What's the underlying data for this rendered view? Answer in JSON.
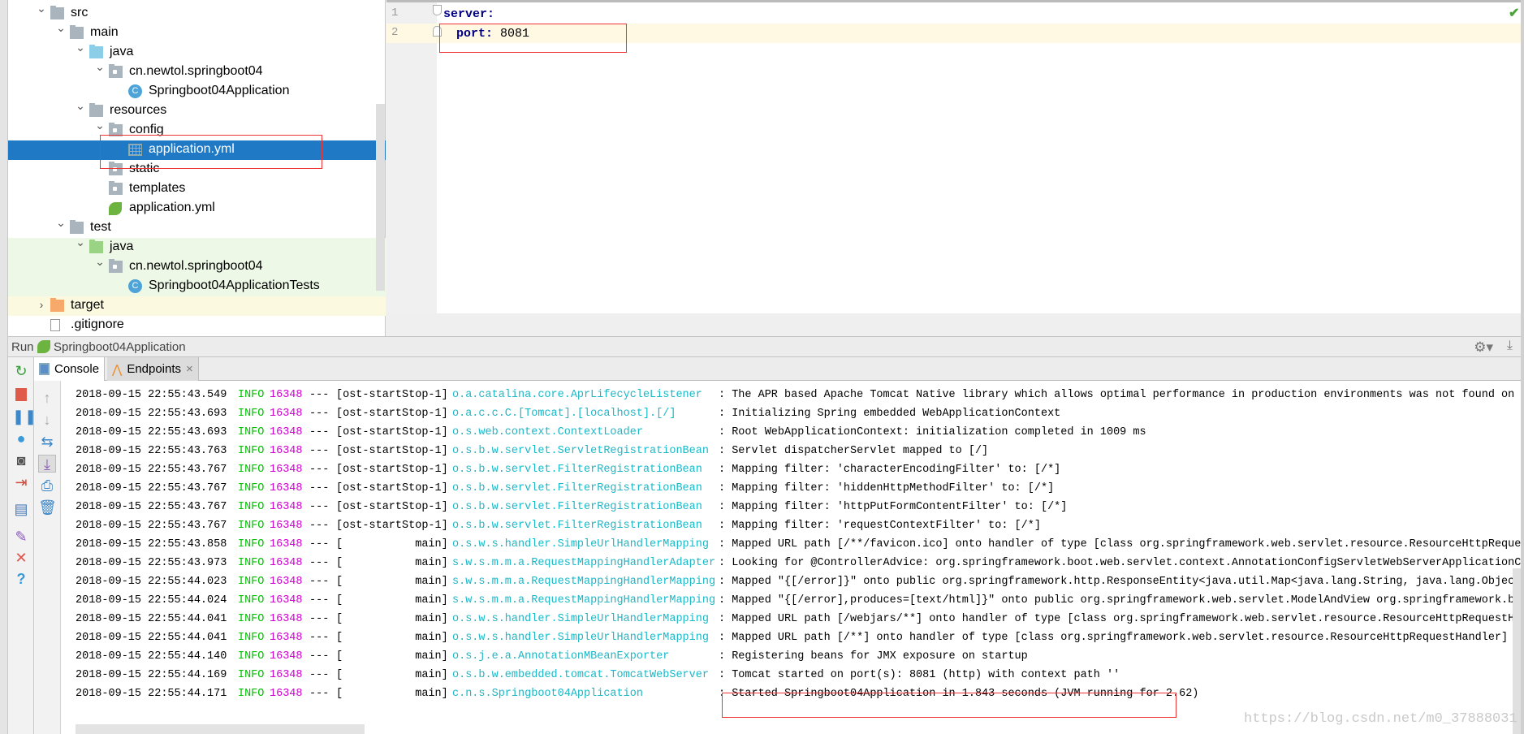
{
  "project_tree": [
    {
      "label": "src",
      "depth": 0,
      "chevron": "down",
      "icon": "folder-icon",
      "style": ""
    },
    {
      "label": "main",
      "depth": 1,
      "chevron": "down",
      "icon": "folder-icon",
      "style": ""
    },
    {
      "label": "java",
      "depth": 2,
      "chevron": "down",
      "icon": "source-folder-icon",
      "style": ""
    },
    {
      "label": "cn.newtol.springboot04",
      "depth": 3,
      "chevron": "down",
      "icon": "package-icon",
      "style": ""
    },
    {
      "label": "Springboot04Application",
      "depth": 4,
      "chevron": "",
      "icon": "spring-boot-class-icon",
      "style": ""
    },
    {
      "label": "resources",
      "depth": 2,
      "chevron": "down",
      "icon": "resources-folder-icon",
      "style": ""
    },
    {
      "label": "config",
      "depth": 3,
      "chevron": "down",
      "icon": "package-icon",
      "style": ""
    },
    {
      "label": "application.yml",
      "depth": 4,
      "chevron": "",
      "icon": "yaml-file-icon",
      "style": "sel"
    },
    {
      "label": "static",
      "depth": 3,
      "chevron": "",
      "icon": "package-icon",
      "style": ""
    },
    {
      "label": "templates",
      "depth": 3,
      "chevron": "",
      "icon": "package-icon",
      "style": ""
    },
    {
      "label": "application.yml",
      "depth": 3,
      "chevron": "",
      "icon": "spring-config-icon",
      "style": ""
    },
    {
      "label": "test",
      "depth": 1,
      "chevron": "down",
      "icon": "folder-icon",
      "style": ""
    },
    {
      "label": "java",
      "depth": 2,
      "chevron": "down",
      "icon": "test-folder-icon",
      "style": "test"
    },
    {
      "label": "cn.newtol.springboot04",
      "depth": 3,
      "chevron": "down",
      "icon": "package-icon",
      "style": "test"
    },
    {
      "label": "Springboot04ApplicationTests",
      "depth": 4,
      "chevron": "",
      "icon": "test-class-icon",
      "style": "test"
    },
    {
      "label": "target",
      "depth": 0,
      "chevron": "right",
      "icon": "excluded-folder-icon",
      "style": "target"
    },
    {
      "label": ".gitignore",
      "depth": 0,
      "chevron": "",
      "icon": "text-file-icon",
      "style": ""
    }
  ],
  "editor": {
    "line_numbers": [
      "1",
      "2"
    ],
    "line1_key": "server:",
    "line2_key": "port:",
    "line2_value": " 8081",
    "status_icon": "checkmark-icon"
  },
  "run_bar": {
    "label": "Run",
    "config": "Springboot04Application"
  },
  "tabs": {
    "console": "Console",
    "endpoints": "Endpoints",
    "close": "×"
  },
  "console_lines": [
    {
      "ts": "2018-09-15 22:55:43.549",
      "level": "INFO",
      "pid": "16348",
      "sep": "---",
      "thread": "[ost-startStop-1]",
      "logger": "o.a.catalina.core.AprLifecycleListener",
      "msg": ": The APR based Apache Tomcat Native library which allows optimal performance in production environments was not found on th"
    },
    {
      "ts": "2018-09-15 22:55:43.693",
      "level": "INFO",
      "pid": "16348",
      "sep": "---",
      "thread": "[ost-startStop-1]",
      "logger": "o.a.c.c.C.[Tomcat].[localhost].[/]",
      "msg": ": Initializing Spring embedded WebApplicationContext"
    },
    {
      "ts": "2018-09-15 22:55:43.693",
      "level": "INFO",
      "pid": "16348",
      "sep": "---",
      "thread": "[ost-startStop-1]",
      "logger": "o.s.web.context.ContextLoader",
      "msg": ": Root WebApplicationContext: initialization completed in 1009 ms"
    },
    {
      "ts": "2018-09-15 22:55:43.763",
      "level": "INFO",
      "pid": "16348",
      "sep": "---",
      "thread": "[ost-startStop-1]",
      "logger": "o.s.b.w.servlet.ServletRegistrationBean",
      "msg": ": Servlet dispatcherServlet mapped to [/]"
    },
    {
      "ts": "2018-09-15 22:55:43.767",
      "level": "INFO",
      "pid": "16348",
      "sep": "---",
      "thread": "[ost-startStop-1]",
      "logger": "o.s.b.w.servlet.FilterRegistrationBean",
      "msg": ": Mapping filter: 'characterEncodingFilter' to: [/*]"
    },
    {
      "ts": "2018-09-15 22:55:43.767",
      "level": "INFO",
      "pid": "16348",
      "sep": "---",
      "thread": "[ost-startStop-1]",
      "logger": "o.s.b.w.servlet.FilterRegistrationBean",
      "msg": ": Mapping filter: 'hiddenHttpMethodFilter' to: [/*]"
    },
    {
      "ts": "2018-09-15 22:55:43.767",
      "level": "INFO",
      "pid": "16348",
      "sep": "---",
      "thread": "[ost-startStop-1]",
      "logger": "o.s.b.w.servlet.FilterRegistrationBean",
      "msg": ": Mapping filter: 'httpPutFormContentFilter' to: [/*]"
    },
    {
      "ts": "2018-09-15 22:55:43.767",
      "level": "INFO",
      "pid": "16348",
      "sep": "---",
      "thread": "[ost-startStop-1]",
      "logger": "o.s.b.w.servlet.FilterRegistrationBean",
      "msg": ": Mapping filter: 'requestContextFilter' to: [/*]"
    },
    {
      "ts": "2018-09-15 22:55:43.858",
      "level": "INFO",
      "pid": "16348",
      "sep": "---",
      "thread": "[           main]",
      "logger": "o.s.w.s.handler.SimpleUrlHandlerMapping",
      "msg": ": Mapped URL path [/**/favicon.ico] onto handler of type [class org.springframework.web.servlet.resource.ResourceHttpRequest"
    },
    {
      "ts": "2018-09-15 22:55:43.973",
      "level": "INFO",
      "pid": "16348",
      "sep": "---",
      "thread": "[           main]",
      "logger": "s.w.s.m.m.a.RequestMappingHandlerAdapter",
      "msg": ": Looking for @ControllerAdvice: org.springframework.boot.web.servlet.context.AnnotationConfigServletWebServerApplicationCo"
    },
    {
      "ts": "2018-09-15 22:55:44.023",
      "level": "INFO",
      "pid": "16348",
      "sep": "---",
      "thread": "[           main]",
      "logger": "s.w.s.m.m.a.RequestMappingHandlerMapping",
      "msg": ": Mapped \"{[/error]}\" onto public org.springframework.http.ResponseEntity<java.util.Map<java.lang.String, java.lang.Object>>"
    },
    {
      "ts": "2018-09-15 22:55:44.024",
      "level": "INFO",
      "pid": "16348",
      "sep": "---",
      "thread": "[           main]",
      "logger": "s.w.s.m.m.a.RequestMappingHandlerMapping",
      "msg": ": Mapped \"{[/error],produces=[text/html]}\" onto public org.springframework.web.servlet.ModelAndView org.springframework.boot"
    },
    {
      "ts": "2018-09-15 22:55:44.041",
      "level": "INFO",
      "pid": "16348",
      "sep": "---",
      "thread": "[           main]",
      "logger": "o.s.w.s.handler.SimpleUrlHandlerMapping",
      "msg": ": Mapped URL path [/webjars/**] onto handler of type [class org.springframework.web.servlet.resource.ResourceHttpRequestHand"
    },
    {
      "ts": "2018-09-15 22:55:44.041",
      "level": "INFO",
      "pid": "16348",
      "sep": "---",
      "thread": "[           main]",
      "logger": "o.s.w.s.handler.SimpleUrlHandlerMapping",
      "msg": ": Mapped URL path [/**] onto handler of type [class org.springframework.web.servlet.resource.ResourceHttpRequestHandler]"
    },
    {
      "ts": "2018-09-15 22:55:44.140",
      "level": "INFO",
      "pid": "16348",
      "sep": "---",
      "thread": "[           main]",
      "logger": "o.s.j.e.a.AnnotationMBeanExporter",
      "msg": ": Registering beans for JMX exposure on startup"
    },
    {
      "ts": "2018-09-15 22:55:44.169",
      "level": "INFO",
      "pid": "16348",
      "sep": "---",
      "thread": "[           main]",
      "logger": "o.s.b.w.embedded.tomcat.TomcatWebServer",
      "msg": ": Tomcat started on port(s): 8081 (http) with context path ''"
    },
    {
      "ts": "2018-09-15 22:55:44.171",
      "level": "INFO",
      "pid": "16348",
      "sep": "---",
      "thread": "[           main]",
      "logger": "c.n.s.Springboot04Application",
      "msg": ": Started Springboot04Application in 1.843 seconds (JVM running for 2.62)"
    }
  ],
  "watermark": "https://blog.csdn.net/m0_37888031",
  "colors": {
    "selection": "#1f79c5",
    "info": "#00c000",
    "pid": "#d000d0",
    "logger": "#1ab8c8",
    "highlight_box": "#ee3333"
  }
}
